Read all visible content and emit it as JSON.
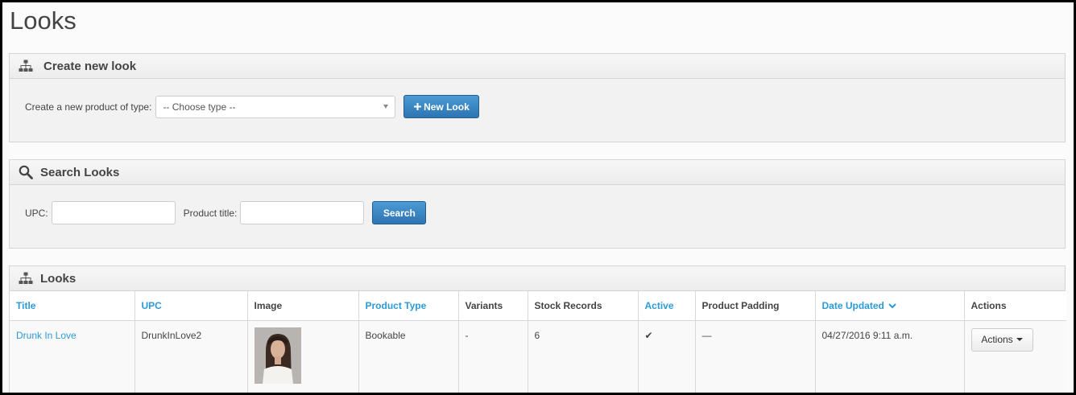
{
  "page": {
    "title": "Looks"
  },
  "create_panel": {
    "heading": "Create new look",
    "label": "Create a new product of type:",
    "select_value": "-- Choose type --",
    "button_label": "New Look"
  },
  "search_panel": {
    "heading": "Search Looks",
    "upc_label": "UPC:",
    "title_label": "Product title:",
    "button_label": "Search"
  },
  "looks_panel": {
    "heading": "Looks",
    "columns": [
      {
        "label": "Title",
        "sortable": true
      },
      {
        "label": "UPC",
        "sortable": true
      },
      {
        "label": "Image",
        "sortable": false
      },
      {
        "label": "Product Type",
        "sortable": true
      },
      {
        "label": "Variants",
        "sortable": false
      },
      {
        "label": "Stock Records",
        "sortable": false
      },
      {
        "label": "Active",
        "sortable": true
      },
      {
        "label": "Product Padding",
        "sortable": false
      },
      {
        "label": "Date Updated",
        "sortable": true
      },
      {
        "label": "Actions",
        "sortable": false
      }
    ],
    "rows": [
      {
        "title": "Drunk In Love",
        "upc": "DrunkInLove2",
        "product_type": "Bookable",
        "variants": "-",
        "stock_records": "6",
        "active": "✔",
        "product_padding": "—",
        "date_updated": "04/27/2016 9:11 a.m.",
        "actions_label": "Actions"
      }
    ]
  },
  "colors": {
    "link": "#2a9bd6",
    "primary": "#337ab7"
  }
}
